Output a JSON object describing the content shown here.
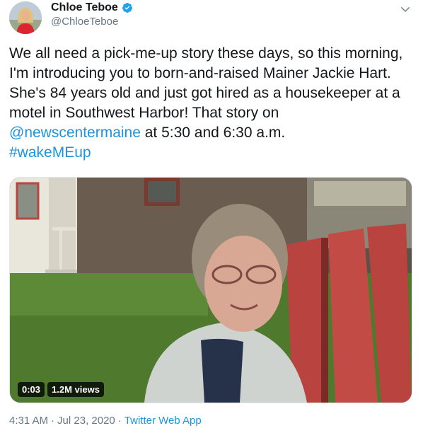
{
  "author": {
    "name": "Chloe Teboe",
    "handle": "@ChloeTeboe",
    "verified": true
  },
  "tweet": {
    "text_part1": "We all need a pick-me-up story these days, so this morning, I'm introducing you to born-and-raised Mainer Jackie Hart. She's 84 years old and just got hired as a housekeeper at a motel in Southwest Harbor! That story on ",
    "mention": "@newscentermaine",
    "text_part2": " at 5:30 and 6:30 a.m.",
    "hashtag": "#wakeMEup"
  },
  "video": {
    "time": "0:03",
    "views": "1.2M views"
  },
  "meta": {
    "time": "4:31 AM",
    "date": "Jul 23, 2020",
    "separator": "·",
    "app": "Twitter Web App"
  },
  "icons": {
    "verified": "verified-badge-icon",
    "chevron": "chevron-down-icon"
  },
  "colors": {
    "link": "#1b95e0",
    "verified": "#1da1f2",
    "muted": "#657786"
  }
}
